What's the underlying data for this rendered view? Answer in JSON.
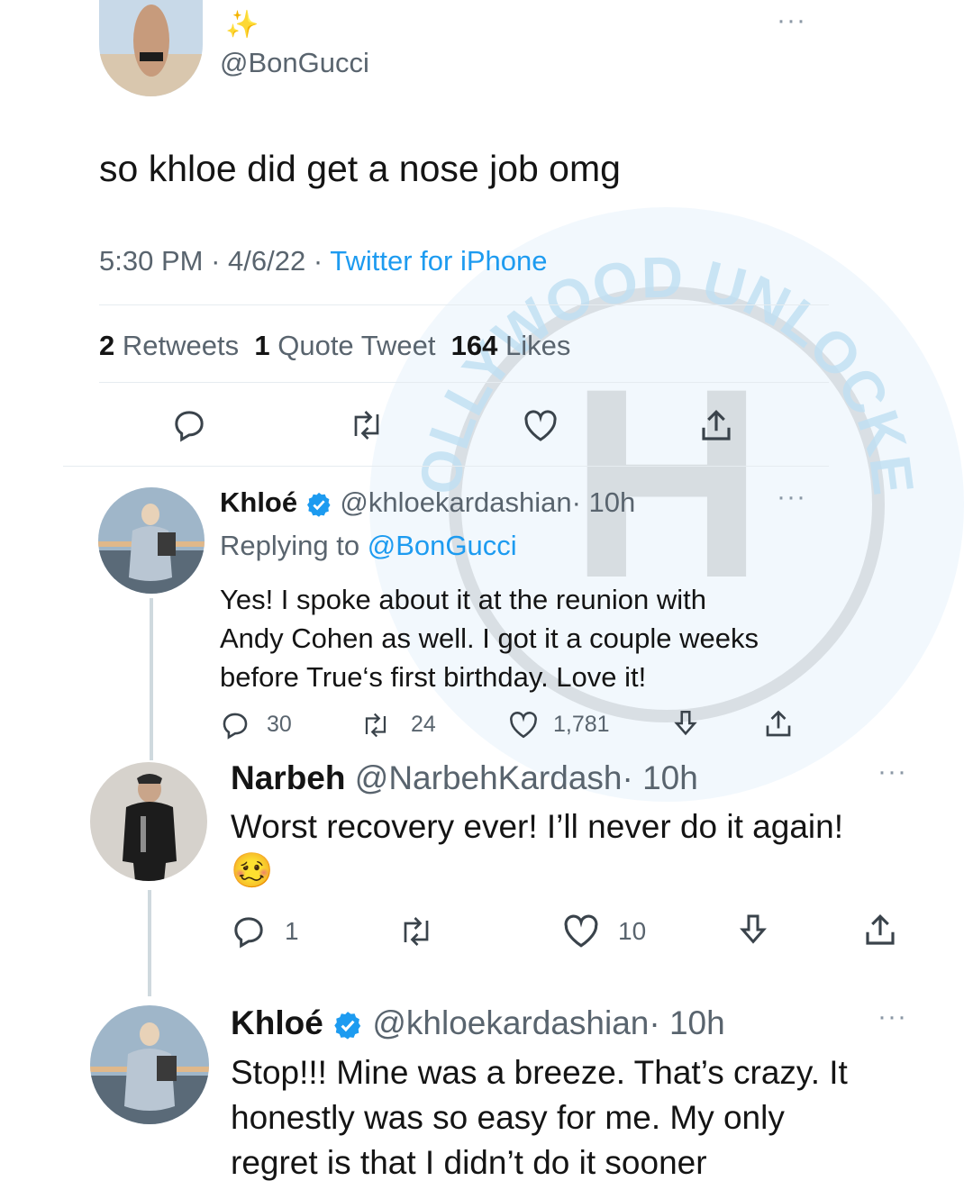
{
  "main_tweet": {
    "display_name": "✨",
    "handle": "@BonGucci",
    "text": "so khloe did get a nose job omg",
    "time": "5:30 PM",
    "date": "4/6/22",
    "sep": "·",
    "source": "Twitter for iPhone",
    "stats": {
      "retweets_count": "2",
      "retweets_label": "Retweets",
      "quotes_count": "1",
      "quotes_label": "Quote Tweet",
      "likes_count": "164",
      "likes_label": "Likes"
    }
  },
  "replies": [
    {
      "name": "Khloé",
      "handle": "@khloekardashian",
      "time": "· 10h",
      "replying_label": "Replying to",
      "replying_to": "@BonGucci",
      "text_lines": [
        "Yes! I spoke about it at the reunion with",
        "Andy Cohen as well. I got it a couple weeks",
        "before True‘s first birthday. Love it!"
      ],
      "replies": "30",
      "retweets": "24",
      "likes": "1,781"
    },
    {
      "name": "Narbeh",
      "handle": "@NarbehKardash",
      "time": "· 10h",
      "text": "Worst recovery ever! I’ll never do it again!",
      "emoji": "🥴",
      "replies": "1",
      "likes": "10"
    },
    {
      "name": "Khloé",
      "handle": "@khloekardashian",
      "time": "· 10h",
      "text_lines": [
        "Stop!!! Mine was a breeze. That’s crazy. It",
        "honestly was so easy for me. My only",
        "regret is that I didn’t do it sooner"
      ]
    }
  ],
  "watermark": {
    "arc_text": "HOLLYWOOD UNLOCKED",
    "letter": "H"
  },
  "colors": {
    "accent": "#1d9bf0",
    "muted": "#59646e",
    "watermark": "#bfe0f3"
  }
}
